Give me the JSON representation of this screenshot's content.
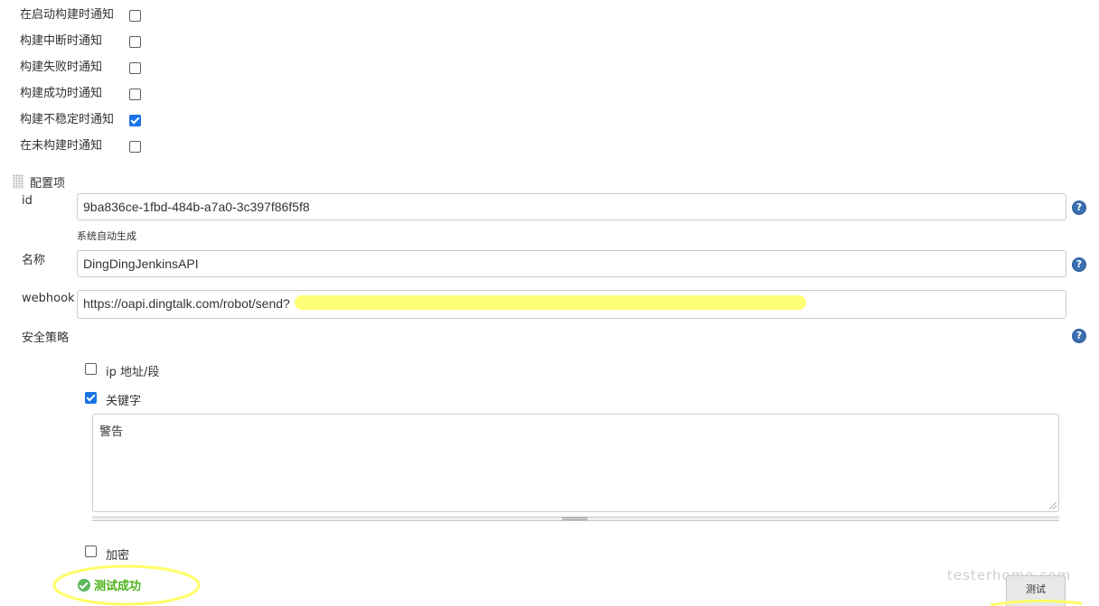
{
  "notify_options": [
    {
      "label": "在启动构建时通知",
      "checked": false
    },
    {
      "label": "构建中断时通知",
      "checked": false
    },
    {
      "label": "构建失败时通知",
      "checked": false
    },
    {
      "label": "构建成功时通知",
      "checked": false
    },
    {
      "label": "构建不稳定时通知",
      "checked": true
    },
    {
      "label": "在未构建时通知",
      "checked": false
    }
  ],
  "config": {
    "section_title": "配置项",
    "id_label": "id",
    "id_value": "9ba836ce-1fbd-484b-a7a0-3c397f86f5f8",
    "id_hint": "系统自动生成",
    "name_label": "名称",
    "name_value": "DingDingJenkinsAPI",
    "webhook_label": "webhook",
    "webhook_value": "https://oapi.dingtalk.com/robot/send?",
    "security_label": "安全策略",
    "help_icon": "?"
  },
  "security": {
    "ip_label": "ip 地址/段",
    "ip_checked": false,
    "keyword_label": "关键字",
    "keyword_checked": true,
    "keyword_value": "警告",
    "encrypt_label": "加密",
    "encrypt_checked": false
  },
  "test": {
    "button_label": "测试",
    "result": "测试成功"
  },
  "watermark": "testerhome.com",
  "colors": {
    "success": "#4cb31a",
    "help": "#3a6fb0",
    "highlight": "#ffff66",
    "checkbox_checked": "#1a73e8"
  }
}
